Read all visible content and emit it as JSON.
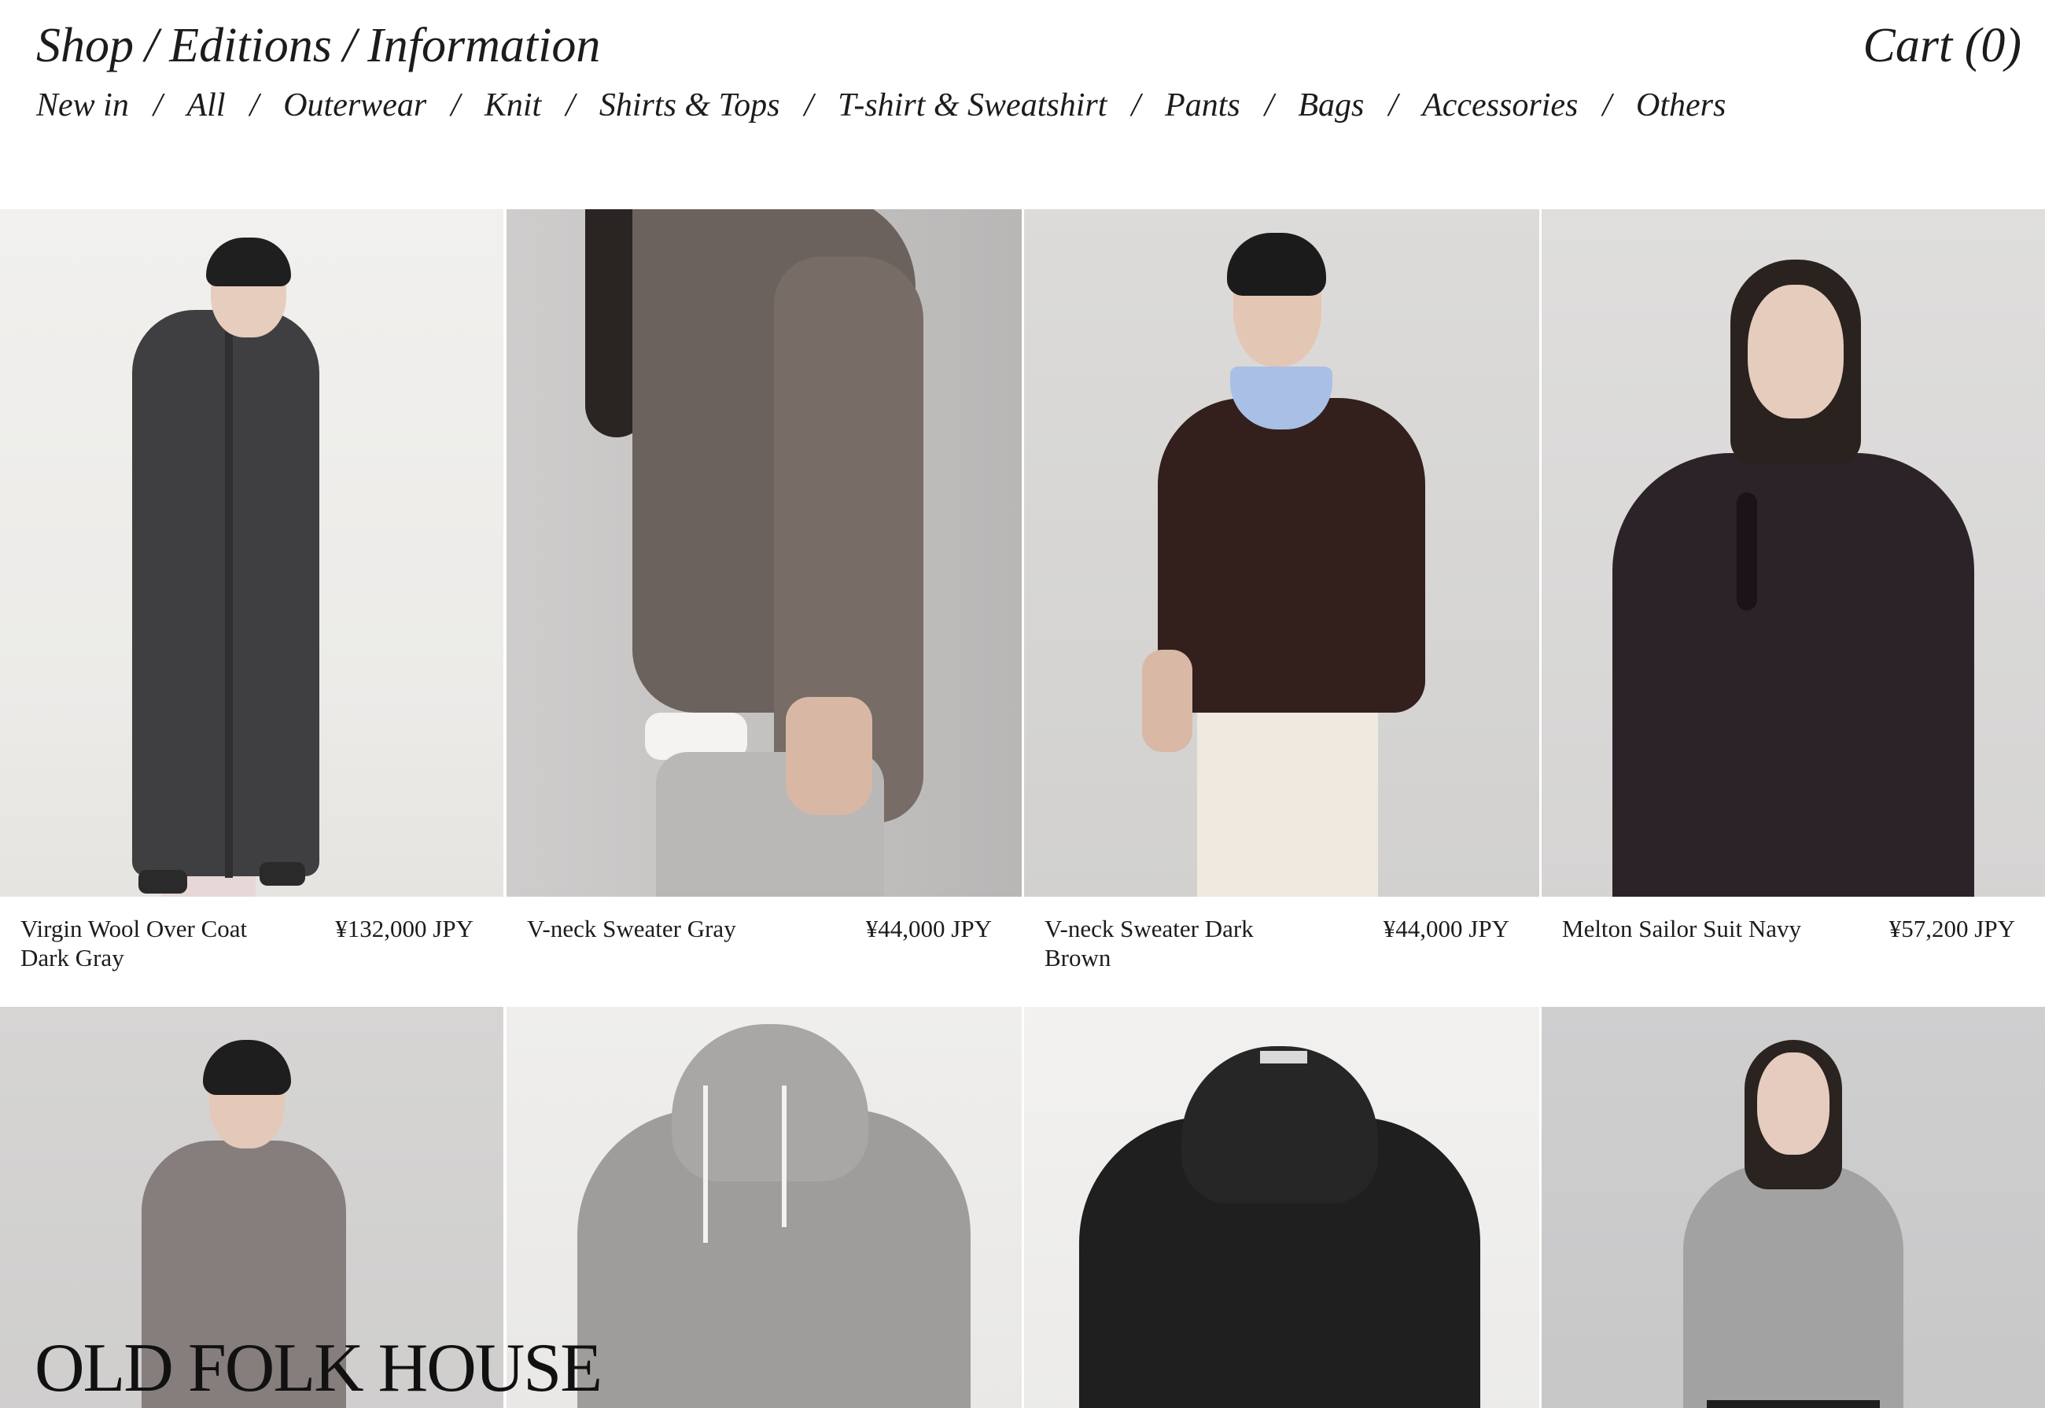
{
  "header": {
    "nav": [
      "Shop",
      "Editions",
      "Information"
    ],
    "cart_label": "Cart (0)"
  },
  "categories": [
    "New in",
    "All",
    "Outerwear",
    "Knit",
    "Shirts & Tops",
    "T-shirt & Sweatshirt",
    "Pants",
    "Bags",
    "Accessories",
    "Others"
  ],
  "products": [
    {
      "name": "Virgin Wool Over Coat Dark Gray",
      "price": "¥132,000 JPY"
    },
    {
      "name": "V-neck Sweater Gray",
      "price": "¥44,000 JPY"
    },
    {
      "name": "V-neck Sweater Dark Brown",
      "price": "¥44,000 JPY"
    },
    {
      "name": "Melton Sailor Suit Navy",
      "price": "¥57,200 JPY"
    }
  ],
  "brand": "OLD FOLK HOUSE",
  "colors": {
    "text": "#1c1c1c",
    "background": "#ffffff",
    "photo_bg_light": "#eeedeb",
    "photo_bg_gray": "#c9c8c8"
  }
}
